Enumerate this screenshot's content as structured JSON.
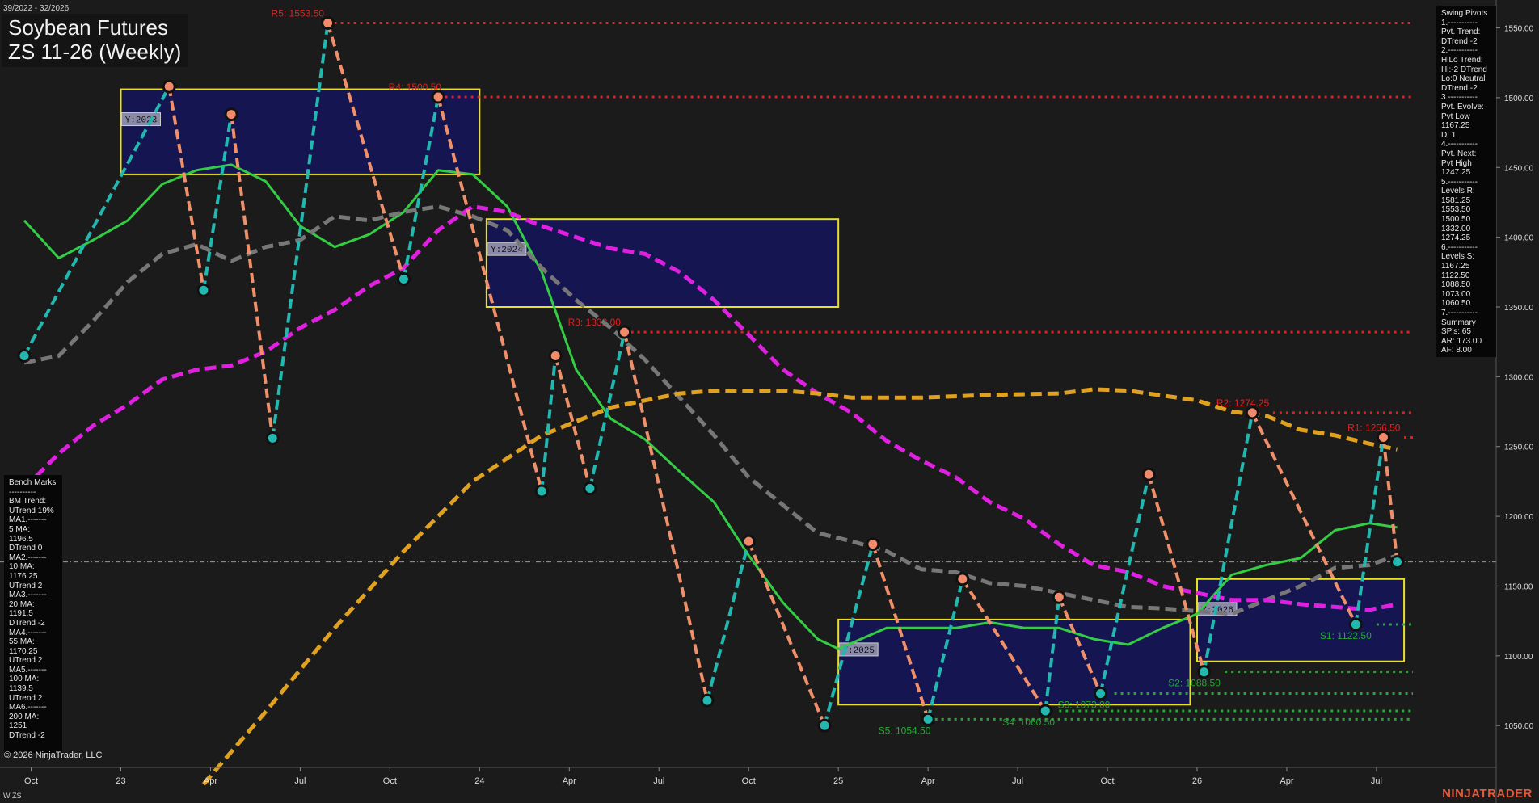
{
  "header": {
    "date_range": "39/2022 - 32/2026",
    "title_line1": "Soybean Futures",
    "title_line2": "ZS 11-26 (Weekly)"
  },
  "swing_panel": {
    "lines": [
      "Swing Pivots",
      "1.-----------",
      "Pvt. Trend:",
      "DTrend -2",
      "2.-----------",
      "HiLo Trend:",
      "Hi:-2 DTrend",
      "Lo:0 Neutral",
      "DTrend -2",
      "3.-----------",
      "Pvt. Evolve:",
      "Pvt Low",
      "1167.25",
      "D: 1",
      "4.-----------",
      "Pvt. Next:",
      "Pvt High",
      "1247.25",
      "5.-----------",
      "Levels R:",
      "1581.25",
      "1553.50",
      "1500.50",
      "1332.00",
      "1274.25",
      "6.-----------",
      "Levels S:",
      "1167.25",
      "1122.50",
      "1088.50",
      "1073.00",
      "1060.50",
      "7.-----------",
      "Summary",
      "SP's: 65",
      "AR: 173.00",
      "AF: 8.00"
    ]
  },
  "bench_panel": {
    "lines": [
      "Bench Marks",
      "----------",
      "BM Trend:",
      "UTrend 19%",
      "MA1.-------",
      "5 MA:",
      "1196.5",
      "DTrend 0",
      "MA2.-------",
      "10 MA:",
      "1176.25",
      "UTrend 2",
      "MA3.-------",
      "20 MA:",
      "1191.5",
      "DTrend -2",
      "MA4.-------",
      "55 MA:",
      "1170.25",
      "UTrend 2",
      "MA5.-------",
      "100 MA:",
      "1139.5",
      "UTrend 2",
      "MA6.-------",
      "200 MA:",
      "1251",
      "DTrend -2"
    ]
  },
  "footer": {
    "copyright": "© 2026 NinjaTrader, LLC",
    "symbol": "W ZS",
    "brand": "NINJATRADER"
  },
  "colors": {
    "background": "#1b1b1b",
    "resistance": "#e02020",
    "support": "#22aa33",
    "ma_green": "#33cc44",
    "ma_gray": "#777777",
    "ma_magenta": "#e020e0",
    "ma_orange": "#e0a020",
    "swing_up": "#22b8b0",
    "swing_down": "#f0906a",
    "year_box_fill": "#14145a",
    "year_box_border": "#e8e020"
  },
  "chart_data": {
    "type": "line",
    "title": "Soybean Futures ZS 11-26 (Weekly)",
    "ylim": [
      1020,
      1570
    ],
    "y_ticks": [
      1050,
      1100,
      1150,
      1200,
      1250,
      1300,
      1350,
      1400,
      1450,
      1500,
      1550
    ],
    "y_tick_labels": [
      "1050.00",
      "1100.00",
      "1150.00",
      "1200.00",
      "1250.00",
      "1300.00",
      "1350.00",
      "1400.00",
      "1450.00",
      "1500.00",
      "1550.00"
    ],
    "xlim": [
      0,
      198
    ],
    "x_ticks": [
      1,
      14,
      27,
      40,
      53,
      66,
      79,
      92,
      105,
      118,
      131,
      144,
      157,
      170,
      183,
      196
    ],
    "x_tick_labels": [
      "Oct",
      "23",
      "Apr",
      "Jul",
      "Oct",
      "24",
      "Apr",
      "Jul",
      "Oct",
      "25",
      "Apr",
      "Jul",
      "Oct",
      "26",
      "Apr",
      "Jul"
    ],
    "reference_line": 1167.25,
    "resistance_levels": [
      {
        "label": "R5: 1553.50",
        "value": 1553.5,
        "start": 44
      },
      {
        "label": "R4: 1500.50",
        "value": 1500.5,
        "start": 61
      },
      {
        "label": "R3: 1332.00",
        "value": 1332.0,
        "start": 87
      },
      {
        "label": "R2: 1274.25",
        "value": 1274.25,
        "start": 181
      },
      {
        "label": "R1: 1256.50",
        "value": 1256.5,
        "start": 200
      }
    ],
    "support_levels": [
      {
        "label": "S5: 1054.50",
        "value": 1054.5,
        "start": 132
      },
      {
        "label": "S4: 1060.50",
        "value": 1060.5,
        "start": 150
      },
      {
        "label": "S3: 1073.00",
        "value": 1073.0,
        "start": 158
      },
      {
        "label": "S2: 1088.50",
        "value": 1088.5,
        "start": 174
      },
      {
        "label": "S1: 1122.50",
        "value": 1122.5,
        "start": 196
      }
    ],
    "year_boxes": [
      {
        "label": "Y:2023",
        "x0": 14,
        "x1": 66,
        "y0": 1445,
        "y1": 1506
      },
      {
        "label": "Y:2024",
        "x0": 67,
        "x1": 118,
        "y0": 1350,
        "y1": 1413
      },
      {
        "label": "Y:2025",
        "x0": 118,
        "x1": 169,
        "y0": 1065,
        "y1": 1126
      },
      {
        "label": "Y:2026",
        "x0": 170,
        "x1": 200,
        "y0": 1096,
        "y1": 1155
      }
    ],
    "swing_pivots": [
      {
        "x": 0,
        "y": 1315
      },
      {
        "x": 21,
        "y": 1508
      },
      {
        "x": 26,
        "y": 1362
      },
      {
        "x": 30,
        "y": 1488
      },
      {
        "x": 36,
        "y": 1256
      },
      {
        "x": 44,
        "y": 1553.5
      },
      {
        "x": 55,
        "y": 1370
      },
      {
        "x": 60,
        "y": 1500.5
      },
      {
        "x": 75,
        "y": 1218
      },
      {
        "x": 77,
        "y": 1315
      },
      {
        "x": 82,
        "y": 1220
      },
      {
        "x": 87,
        "y": 1332
      },
      {
        "x": 99,
        "y": 1068
      },
      {
        "x": 105,
        "y": 1182
      },
      {
        "x": 116,
        "y": 1050
      },
      {
        "x": 123,
        "y": 1180
      },
      {
        "x": 131,
        "y": 1054.5
      },
      {
        "x": 136,
        "y": 1155
      },
      {
        "x": 148,
        "y": 1060.5
      },
      {
        "x": 150,
        "y": 1142
      },
      {
        "x": 156,
        "y": 1073
      },
      {
        "x": 163,
        "y": 1230
      },
      {
        "x": 171,
        "y": 1088.5
      },
      {
        "x": 178,
        "y": 1274.25
      },
      {
        "x": 193,
        "y": 1122.5
      },
      {
        "x": 197,
        "y": 1256.5
      },
      {
        "x": 199,
        "y": 1167.25
      }
    ],
    "series": [
      {
        "color": "#33cc44",
        "points": [
          [
            0,
            1412
          ],
          [
            5,
            1385
          ],
          [
            10,
            1398
          ],
          [
            15,
            1412
          ],
          [
            20,
            1438
          ],
          [
            25,
            1448
          ],
          [
            30,
            1452
          ],
          [
            35,
            1440
          ],
          [
            40,
            1408
          ],
          [
            45,
            1393
          ],
          [
            50,
            1402
          ],
          [
            55,
            1418
          ],
          [
            60,
            1448
          ],
          [
            65,
            1445
          ],
          [
            70,
            1422
          ],
          [
            75,
            1375
          ],
          [
            80,
            1305
          ],
          [
            85,
            1270
          ],
          [
            90,
            1255
          ],
          [
            95,
            1232
          ],
          [
            100,
            1210
          ],
          [
            105,
            1172
          ],
          [
            110,
            1138
          ],
          [
            115,
            1112
          ],
          [
            118,
            1105
          ],
          [
            125,
            1120
          ],
          [
            130,
            1120
          ],
          [
            135,
            1120
          ],
          [
            140,
            1124
          ],
          [
            145,
            1120
          ],
          [
            150,
            1120
          ],
          [
            155,
            1112
          ],
          [
            160,
            1108
          ],
          [
            165,
            1120
          ],
          [
            170,
            1130
          ],
          [
            175,
            1158
          ],
          [
            180,
            1165
          ],
          [
            185,
            1170
          ],
          [
            190,
            1190
          ],
          [
            195,
            1195
          ],
          [
            199,
            1192
          ]
        ]
      },
      {
        "color": "#777777",
        "points": [
          [
            0,
            1310
          ],
          [
            5,
            1315
          ],
          [
            10,
            1340
          ],
          [
            15,
            1368
          ],
          [
            20,
            1388
          ],
          [
            25,
            1395
          ],
          [
            30,
            1383
          ],
          [
            35,
            1393
          ],
          [
            40,
            1398
          ],
          [
            45,
            1415
          ],
          [
            50,
            1412
          ],
          [
            55,
            1418
          ],
          [
            60,
            1422
          ],
          [
            65,
            1415
          ],
          [
            70,
            1405
          ],
          [
            75,
            1378
          ],
          [
            80,
            1355
          ],
          [
            85,
            1335
          ],
          [
            90,
            1312
          ],
          [
            95,
            1285
          ],
          [
            100,
            1258
          ],
          [
            105,
            1228
          ],
          [
            110,
            1208
          ],
          [
            115,
            1188
          ],
          [
            120,
            1182
          ],
          [
            125,
            1175
          ],
          [
            130,
            1162
          ],
          [
            135,
            1160
          ],
          [
            140,
            1152
          ],
          [
            145,
            1150
          ],
          [
            150,
            1145
          ],
          [
            155,
            1140
          ],
          [
            160,
            1135
          ],
          [
            165,
            1134
          ],
          [
            170,
            1132
          ],
          [
            175,
            1130
          ],
          [
            180,
            1140
          ],
          [
            185,
            1150
          ],
          [
            190,
            1163
          ],
          [
            195,
            1165
          ],
          [
            199,
            1172
          ]
        ]
      },
      {
        "color": "#e020e0",
        "points": [
          [
            0,
            1220
          ],
          [
            5,
            1245
          ],
          [
            10,
            1265
          ],
          [
            15,
            1280
          ],
          [
            20,
            1298
          ],
          [
            25,
            1305
          ],
          [
            30,
            1308
          ],
          [
            35,
            1318
          ],
          [
            40,
            1335
          ],
          [
            45,
            1348
          ],
          [
            50,
            1365
          ],
          [
            55,
            1378
          ],
          [
            60,
            1405
          ],
          [
            65,
            1422
          ],
          [
            70,
            1418
          ],
          [
            75,
            1408
          ],
          [
            80,
            1400
          ],
          [
            85,
            1392
          ],
          [
            90,
            1388
          ],
          [
            95,
            1375
          ],
          [
            100,
            1355
          ],
          [
            105,
            1330
          ],
          [
            110,
            1305
          ],
          [
            115,
            1288
          ],
          [
            120,
            1274
          ],
          [
            125,
            1254
          ],
          [
            130,
            1240
          ],
          [
            135,
            1228
          ],
          [
            140,
            1210
          ],
          [
            145,
            1198
          ],
          [
            150,
            1180
          ],
          [
            155,
            1165
          ],
          [
            160,
            1160
          ],
          [
            165,
            1150
          ],
          [
            170,
            1145
          ],
          [
            175,
            1140
          ],
          [
            180,
            1140
          ],
          [
            185,
            1137
          ],
          [
            190,
            1135
          ],
          [
            195,
            1133
          ],
          [
            199,
            1137
          ]
        ]
      },
      {
        "color": "#e0a020",
        "points": [
          [
            26,
            1008
          ],
          [
            35,
            1060
          ],
          [
            45,
            1120
          ],
          [
            55,
            1175
          ],
          [
            65,
            1225
          ],
          [
            75,
            1258
          ],
          [
            85,
            1278
          ],
          [
            95,
            1288
          ],
          [
            100,
            1290
          ],
          [
            110,
            1290
          ],
          [
            115,
            1288
          ],
          [
            120,
            1285
          ],
          [
            125,
            1285
          ],
          [
            130,
            1285
          ],
          [
            140,
            1287
          ],
          [
            150,
            1288
          ],
          [
            155,
            1291
          ],
          [
            160,
            1290
          ],
          [
            170,
            1283
          ],
          [
            175,
            1275
          ],
          [
            180,
            1272
          ],
          [
            185,
            1262
          ],
          [
            190,
            1258
          ],
          [
            195,
            1252
          ],
          [
            199,
            1248
          ]
        ]
      }
    ]
  }
}
